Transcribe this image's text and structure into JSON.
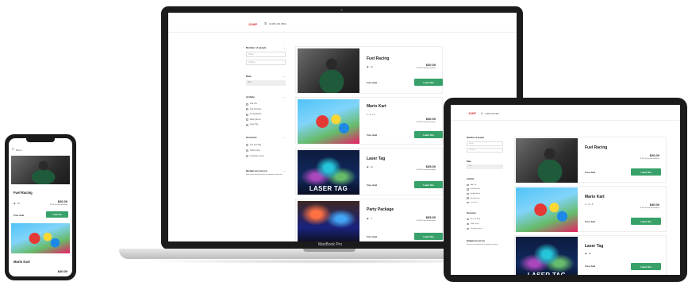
{
  "brand": {
    "accent": "#38a169",
    "logo_text": "JUMP",
    "phone": "01489 230 0894"
  },
  "laptop": {
    "label": "MacBook Pro"
  },
  "mobile": {
    "menu_label": "Menu"
  },
  "filters": {
    "people_title": "Number of people",
    "adults_placeholder": "Adults",
    "children_placeholder": "Children",
    "date_title": "Date",
    "date_placeholder": "Date",
    "activity_title": "Activity",
    "activities": [
      "Add Ons",
      "Kids Activities",
      "Go Ape/Ratch",
      "Racing Event",
      "Laser Tag"
    ],
    "occasion_title": "Occasion",
    "occasions": [
      "Hen and Stag",
      "Child's party",
      "Corporate events"
    ],
    "budget_title": "Budget per person",
    "budget_hint": "How much would you like to spend per person?"
  },
  "products": [
    {
      "name": "Fuel Racing",
      "meta": "8+",
      "price": "$20.00",
      "price_note": "$ 300.00 group bookings",
      "deal": "Free deal",
      "cta": "I want this",
      "image": "fuel"
    },
    {
      "name": "Mario Kart",
      "meta": "1 • 2 • 3",
      "price": "$40.00",
      "price_note": "$ 300.00 group bookings",
      "deal": "Free deal",
      "cta": "I want this",
      "image": "mario"
    },
    {
      "name": "Laser Tag",
      "meta": "8+",
      "price": "$35.00",
      "price_note": "$ 300.00 group bookings",
      "deal": "Free deal",
      "cta": "I want this",
      "image": "laser",
      "image_text": "LASER TAG"
    },
    {
      "name": "Party Package",
      "meta": "4",
      "price": "$65.00",
      "price_note": "$ 300.00 group bookings",
      "deal": "Free deal",
      "cta": "I want this",
      "image": "party"
    }
  ]
}
